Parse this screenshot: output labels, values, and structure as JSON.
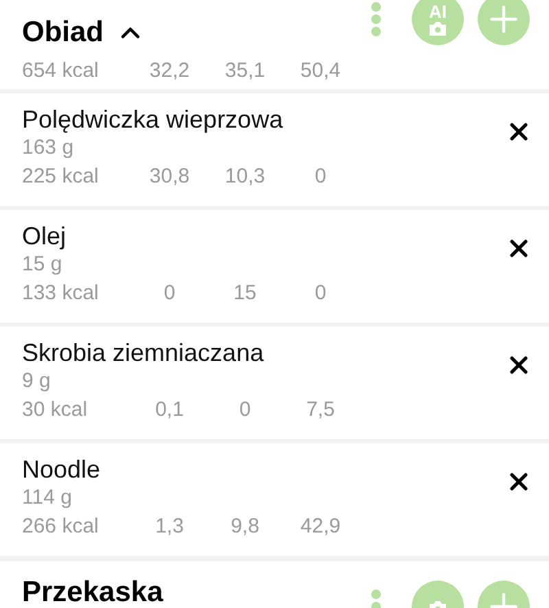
{
  "meal": {
    "title": "Obiad",
    "expanded": true,
    "kcal": "654 kcal",
    "macros": [
      "32,2",
      "35,1",
      "50,4"
    ],
    "ai_label": "AI"
  },
  "items": [
    {
      "name": "Polędwiczka wieprzowa",
      "amount": "163 g",
      "kcal": "225 kcal",
      "macros": [
        "30,8",
        "10,3",
        "0"
      ]
    },
    {
      "name": "Olej",
      "amount": "15 g",
      "kcal": "133 kcal",
      "macros": [
        "0",
        "15",
        "0"
      ]
    },
    {
      "name": "Skrobia ziemniaczana",
      "amount": "9 g",
      "kcal": "30 kcal",
      "macros": [
        "0,1",
        "0",
        "7,5"
      ]
    },
    {
      "name": "Noodle",
      "amount": "114 g",
      "kcal": "266 kcal",
      "macros": [
        "1,3",
        "9,8",
        "42,9"
      ]
    }
  ],
  "next_meal": {
    "title": "Przekaska"
  }
}
